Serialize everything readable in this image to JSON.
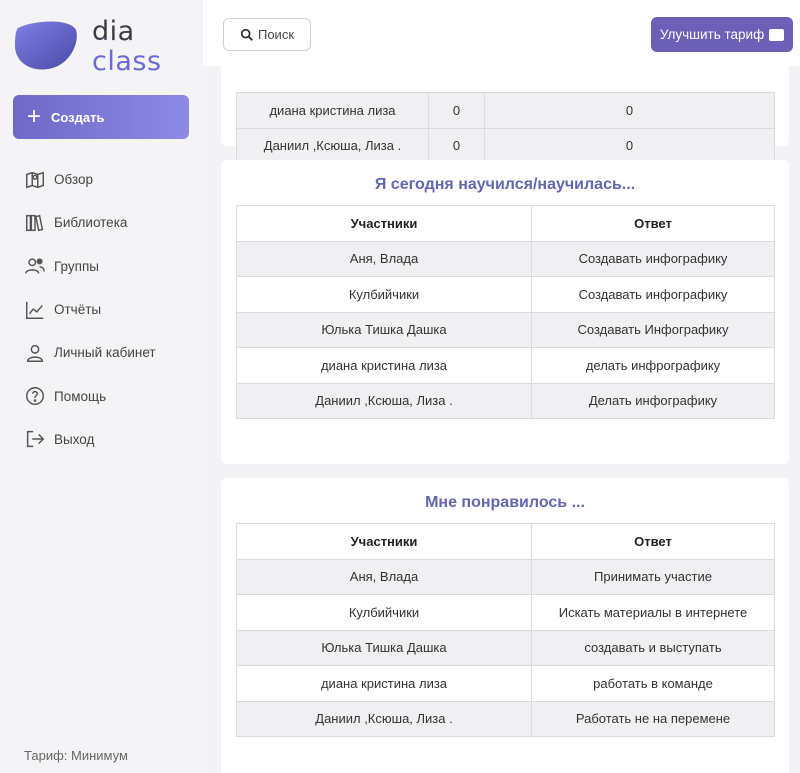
{
  "brand": {
    "line1": "dia",
    "line2": "class"
  },
  "sidebar": {
    "create_label": "Создать",
    "items": [
      {
        "label": "Обзор",
        "icon": "map-icon"
      },
      {
        "label": "Библиотека",
        "icon": "library-icon"
      },
      {
        "label": "Группы",
        "icon": "users-icon"
      },
      {
        "label": "Отчёты",
        "icon": "chart-icon"
      },
      {
        "label": "Личный кабинет",
        "icon": "user-icon"
      },
      {
        "label": "Помощь",
        "icon": "help-icon"
      },
      {
        "label": "Выход",
        "icon": "logout-icon"
      }
    ],
    "tariff": "Тариф: Минимум"
  },
  "topbar": {
    "search_label": "Поиск",
    "upgrade_label": "Улучшить тариф"
  },
  "cards": [
    {
      "rows": [
        {
          "c1": "диана кристина лиза",
          "c2": "0",
          "c3": "0"
        },
        {
          "c1": "Даниил ,Ксюша, Лиза .",
          "c2": "0",
          "c3": "0"
        }
      ]
    },
    {
      "title": "Я сегодня научился/научилась...",
      "headers": [
        "Участники",
        "Ответ"
      ],
      "rows": [
        {
          "c1": "Аня, Влада",
          "c2": "Создавать инфографику"
        },
        {
          "c1": "Кулбийчики",
          "c2": "Создавать инфографику"
        },
        {
          "c1": "Юлька Тишка Дашка",
          "c2": "Создавать Инфографику"
        },
        {
          "c1": "диана кристина лиза",
          "c2": "делать инфрографику"
        },
        {
          "c1": "Даниил ,Ксюша, Лиза .",
          "c2": "Делать инфографику"
        }
      ]
    },
    {
      "title": "Мне понравилось ...",
      "headers": [
        "Участники",
        "Ответ"
      ],
      "rows": [
        {
          "c1": "Аня, Влада",
          "c2": "Принимать участие"
        },
        {
          "c1": "Кулбийчики",
          "c2": "Искать материалы в интернете"
        },
        {
          "c1": "Юлька Тишка Дашка",
          "c2": "создавать и выступать"
        },
        {
          "c1": "диана кристина лиза",
          "c2": "работать в команде"
        },
        {
          "c1": "Даниил ,Ксюша, Лиза .",
          "c2": "Работать не на перемене"
        }
      ]
    }
  ],
  "colors": {
    "accent": "#6c5fb8",
    "title": "#6466b0"
  }
}
